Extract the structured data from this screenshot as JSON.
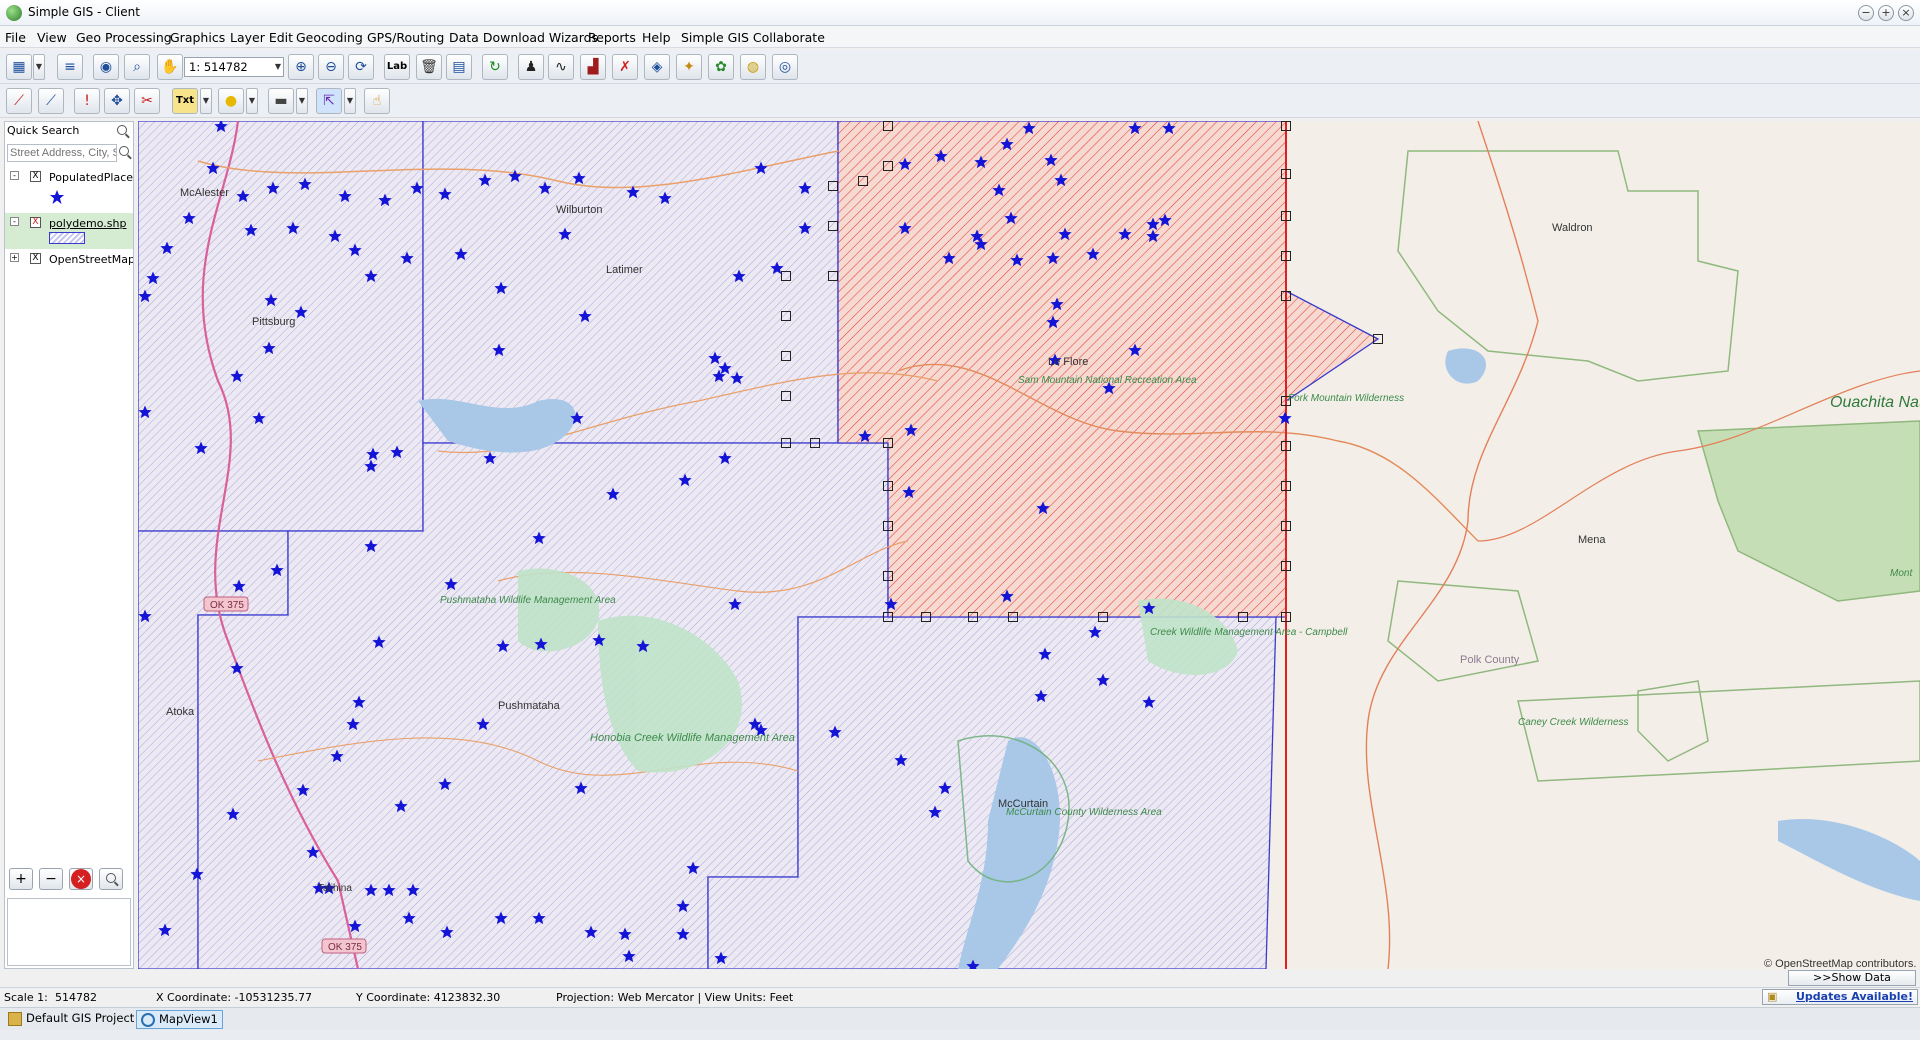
{
  "window": {
    "title": "Simple GIS - Client",
    "controls": [
      "−",
      "+",
      "×"
    ]
  },
  "menu": [
    "File",
    "View",
    "Geo Processing",
    "Graphics",
    "Layer Edit",
    "Geocoding",
    "GPS/Routing",
    "Data Download Wizards",
    "Reports",
    "Help",
    "Simple GIS Collaborate"
  ],
  "toolbar": {
    "scale_value": "1: 514782",
    "label_button": "Lab",
    "text_button": "Txt"
  },
  "left_panel": {
    "quick_search_label": "Quick Search",
    "address_placeholder": "Street Address, City, State",
    "layers": [
      {
        "name": "PopulatedPlaces.shp",
        "checked": "X",
        "expander": "-"
      },
      {
        "name": "polydemo.shp",
        "checked": "X",
        "expander": "-"
      },
      {
        "name": "OpenStreetMap",
        "checked": "X",
        "expander": "+"
      }
    ],
    "buttons": {
      "add": "+",
      "remove": "−",
      "delete": "×"
    }
  },
  "map": {
    "places": [
      "McAlester",
      "Wilburton",
      "Latimer",
      "Pittsburg",
      "Le Flore",
      "Waldron",
      "Mena",
      "Polk County",
      "Atoka",
      "Pushmataha",
      "McCurtain",
      "Talihina"
    ],
    "areas": [
      "Ouachita National Forest",
      "Sam Mountain National Recreation Area",
      "Pushmataha Wildlife Management Area",
      "Honobia Creek Wildlife Management Area",
      "McCurtain County Wilderness Area",
      "Caney Creek Wilderness",
      "Creek Wildlife Management Area - Campbell",
      "Fork Mountain Wilderness"
    ],
    "road_labels": [
      "OK 375",
      "OK 375"
    ],
    "edge_label": "Mont",
    "attribution": "© OpenStreetMap contributors."
  },
  "status": {
    "scale_label": "Scale 1:",
    "scale": "514782",
    "x_coord": "X Coordinate: -10531235.77",
    "y_coord": "Y Coordinate: 4123832.30",
    "projection": "Projection: Web Mercator | View Units: Feet",
    "show_data_panel": ">>Show Data Panel>>",
    "updates": "Updates Available!"
  },
  "tabs": [
    "Default GIS Project",
    "MapView1"
  ],
  "colors": {
    "star": "#1414d6",
    "county_outline": "#3a3acf",
    "selected_fill": "#e2413a",
    "state_line": "#e02020",
    "highway": "#d9609a",
    "forest": "#b9dca9"
  }
}
